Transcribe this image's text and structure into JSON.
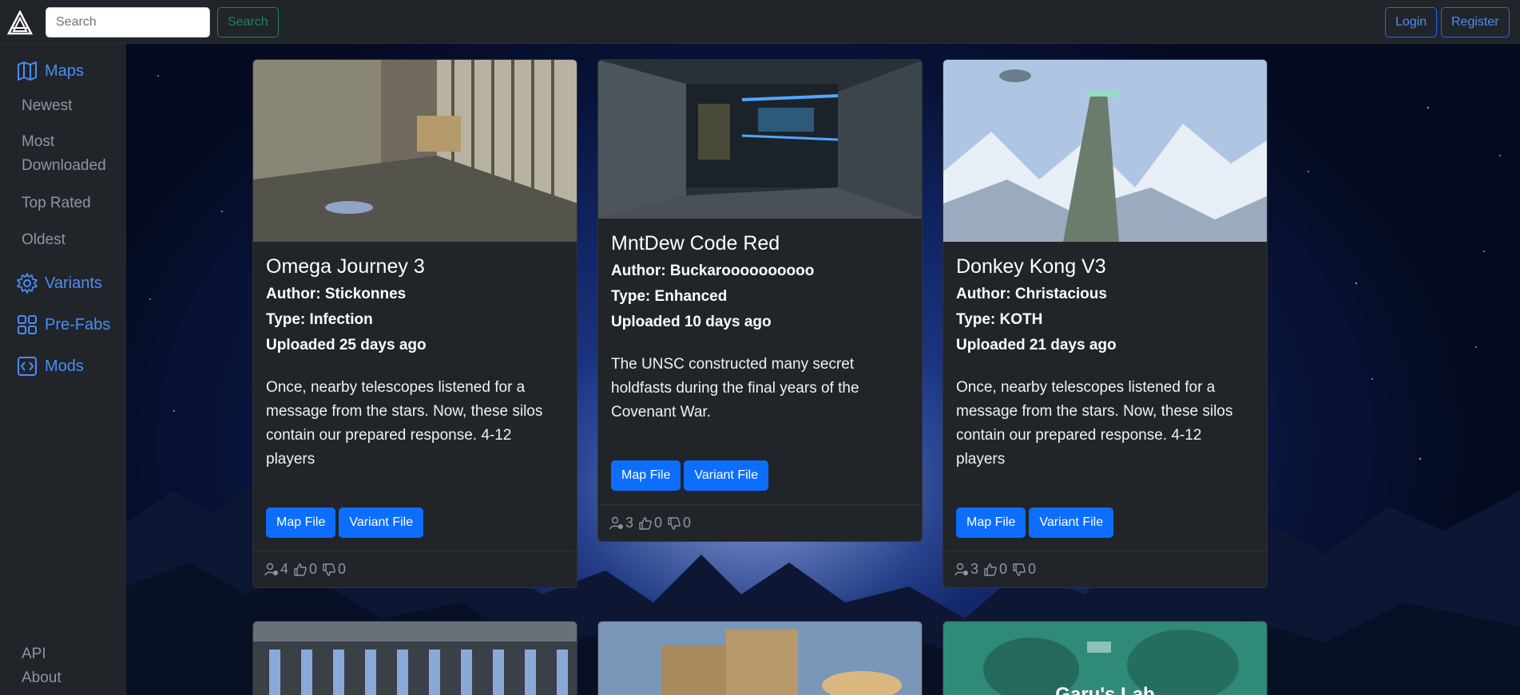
{
  "navbar": {
    "search_placeholder": "Search",
    "search_button": "Search",
    "login_button": "Login",
    "register_button": "Register"
  },
  "sidebar": {
    "maps": "Maps",
    "newest": "Newest",
    "most_downloaded": "Most Downloaded",
    "top_rated": "Top Rated",
    "oldest": "Oldest",
    "variants": "Variants",
    "prefabs": "Pre-Fabs",
    "mods": "Mods",
    "api": "API",
    "about": "About"
  },
  "cards": [
    {
      "title": "Omega Journey 3",
      "author": "Author: Stickonnes",
      "type": "Type: Infection",
      "uploaded": "Uploaded 25 days ago",
      "description": "Once, nearby telescopes listened for a message from the stars. Now, these silos contain our prepared response. 4-12 players",
      "map_button": "Map File",
      "variant_button": "Variant File",
      "downloads": "4",
      "likes": "0",
      "dislikes": "0"
    },
    {
      "title": "MntDew Code Red",
      "author": "Author: Buckaroooooooooo",
      "type": "Type: Enhanced",
      "uploaded": "Uploaded 10 days ago",
      "description": "The UNSC constructed many secret holdfasts during the final years of the Covenant War.",
      "map_button": "Map File",
      "variant_button": "Variant File",
      "downloads": "3",
      "likes": "0",
      "dislikes": "0"
    },
    {
      "title": "Donkey Kong V3",
      "author": "Author: Christacious",
      "type": "Type: KOTH",
      "uploaded": "Uploaded 21 days ago",
      "description": "Once, nearby telescopes listened for a message from the stars. Now, these silos contain our prepared response. 4-12 players",
      "map_button": "Map File",
      "variant_button": "Variant File",
      "downloads": "3",
      "likes": "0",
      "dislikes": "0"
    }
  ],
  "lower_cards": [
    {
      "title": ""
    },
    {
      "title": ""
    },
    {
      "title": "Garu's Lab"
    }
  ],
  "colors": {
    "accent": "#0d6efd",
    "success": "#198754",
    "panel": "#212529"
  }
}
